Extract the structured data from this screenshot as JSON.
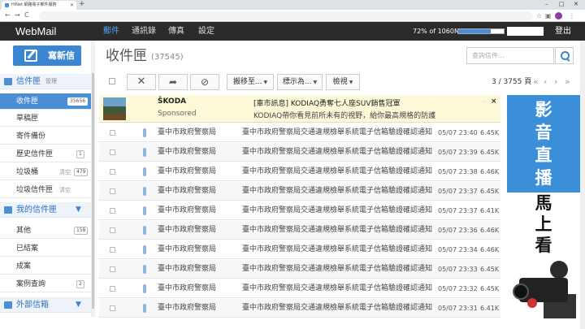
{
  "browser": {
    "tab_title": "HiNet 網路電子郵件服務",
    "new_tab": "+",
    "controls": [
      "–",
      "□",
      "✕"
    ],
    "nav": [
      "←",
      "→",
      "C"
    ]
  },
  "app": {
    "logo": "WebMail",
    "nav": [
      "郵件",
      "通訊錄",
      "傳真",
      "設定"
    ],
    "quota_text": "72% of 1060M",
    "quota_percent": 72,
    "logout": "登出"
  },
  "sidebar": {
    "compose_label": "寫新信",
    "inbox_section": {
      "label": "信件匣",
      "manage": "管理"
    },
    "items": [
      {
        "label": "收件匣",
        "badge": "35656",
        "active": true
      },
      {
        "label": "草稿匣"
      },
      {
        "label": "寄件備份"
      },
      {
        "label": "歷史信件匣",
        "badge": "1"
      },
      {
        "label": "垃圾桶",
        "extra": "清空",
        "badge": "479"
      },
      {
        "label": "垃圾信件匣",
        "extra": "清空"
      }
    ],
    "my_section": {
      "label": "我的信件匣"
    },
    "my_items": [
      {
        "label": "其他",
        "badge": "158"
      },
      {
        "label": "已結案"
      },
      {
        "label": "成案"
      },
      {
        "label": "案例查詢",
        "badge": "2"
      }
    ],
    "external_section": {
      "label": "外部信箱"
    }
  },
  "main": {
    "folder_title": "收件匣",
    "folder_count": "(37545)",
    "search_placeholder": "查詢信件...",
    "toolbar": {
      "delete": "✕",
      "forward": "➦",
      "block": "⊘",
      "move": "搬移至...",
      "mark": "標示為...",
      "view": "檢視"
    },
    "pager": "3 / 3755 頁",
    "pager_arrows": [
      "«",
      "‹",
      "›",
      "»"
    ]
  },
  "ad": {
    "brand": "ŠKODA",
    "sponsored": "Sponsored",
    "title": "[車市訊息] KODIAQ勇奪七人座SUV銷售冠軍",
    "desc": "KODIAQ帶你看見前所未有的視野，給你最高規格的防護",
    "choice": "⁘",
    "close": "×"
  },
  "messages": [
    {
      "sender": "臺中市政府警察局",
      "subject": "臺中市政府警察局交通違規檢舉系統電子信箱驗證確認通知",
      "date": "05/07 23:40",
      "size": "6.45K"
    },
    {
      "sender": "臺中市政府警察局",
      "subject": "臺中市政府警察局交通違規檢舉系統電子信箱驗證確認通知",
      "date": "05/07 23:39",
      "size": "6.45K"
    },
    {
      "sender": "臺中市政府警察局",
      "subject": "臺中市政府警察局交通違規檢舉系統電子信箱驗證確認通知",
      "date": "05/07 23:38",
      "size": "6.46K"
    },
    {
      "sender": "臺中市政府警察局",
      "subject": "臺中市政府警察局交通違規檢舉系統電子信箱驗證確認通知",
      "date": "05/07 23:37",
      "size": "6.45K"
    },
    {
      "sender": "臺中市政府警察局",
      "subject": "臺中市政府警察局交通違規檢舉系統電子信箱驗證確認通知",
      "date": "05/07 23:37",
      "size": "6.41K"
    },
    {
      "sender": "臺中市政府警察局",
      "subject": "臺中市政府警察局交通違規檢舉系統電子信箱驗證確認通知",
      "date": "05/07 23:36",
      "size": "6.46K"
    },
    {
      "sender": "臺中市政府警察局",
      "subject": "臺中市政府警察局交通違規檢舉系統電子信箱驗證確認通知",
      "date": "05/07 23:34",
      "size": "6.46K"
    },
    {
      "sender": "臺中市政府警察局",
      "subject": "臺中市政府警察局交通違規檢舉系統電子信箱驗證確認通知",
      "date": "05/07 23:33",
      "size": "6.45K"
    },
    {
      "sender": "臺中市政府警察局",
      "subject": "臺中市政府警察局交通違規檢舉系統電子信箱驗證確認通知",
      "date": "05/07 23:32",
      "size": "6.45K"
    },
    {
      "sender": "臺中市政府警察局",
      "subject": "臺中市政府警察局交通違規檢舉系統電子信箱驗證確認通知",
      "date": "05/07 23:31",
      "size": "6.41K"
    }
  ],
  "banner": {
    "line1": "影音直播",
    "line2": "馬上看"
  },
  "colors": {
    "accent": "#3a86d0",
    "header": "#2b2b2b",
    "ad_bg": "#fdf9d8",
    "banner_blue": "#3a8fd8"
  }
}
